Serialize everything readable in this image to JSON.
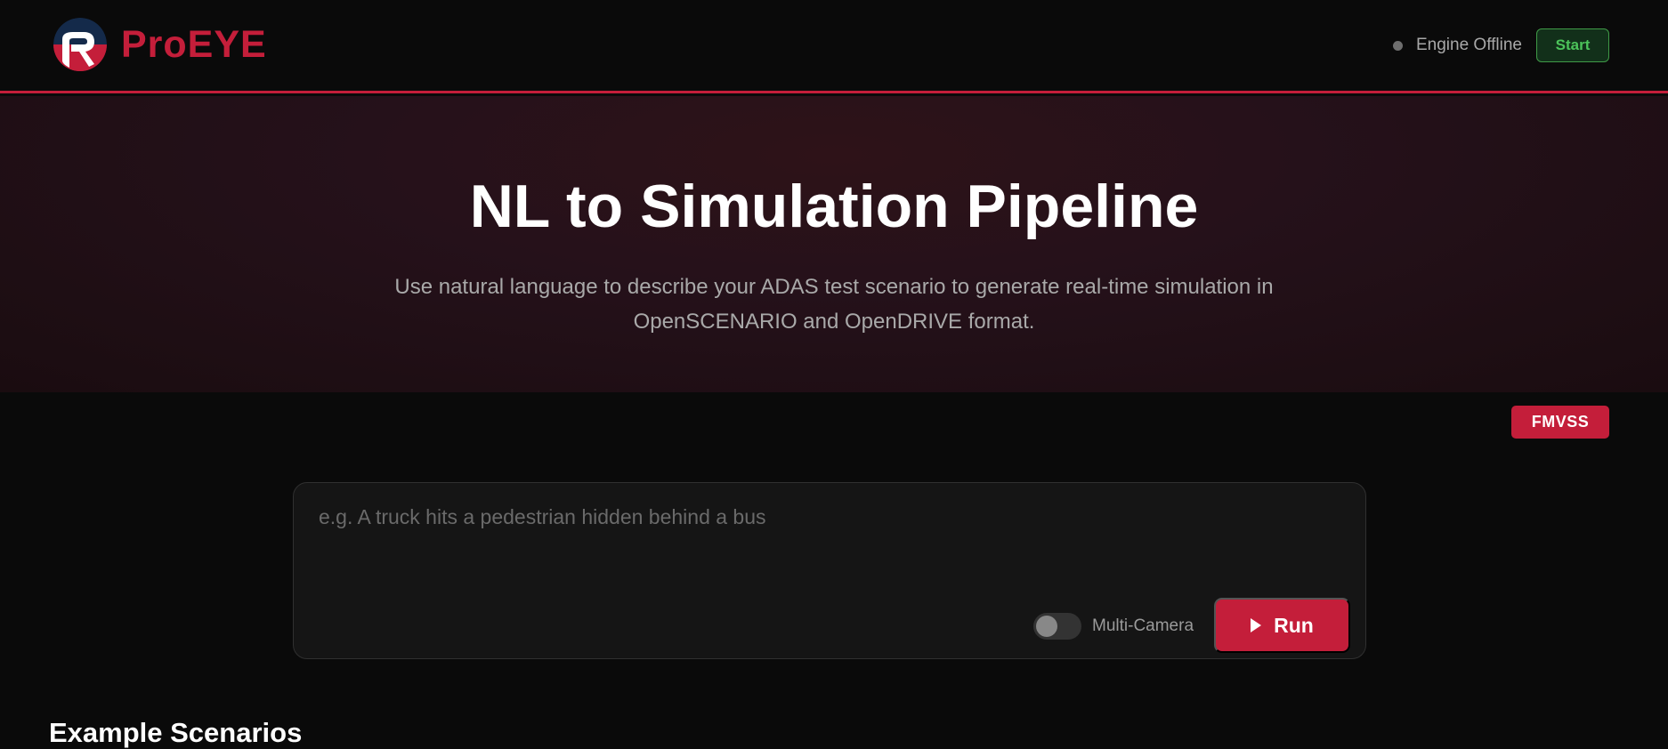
{
  "header": {
    "brand": "ProEYE",
    "engine_status": "Engine Offline",
    "start_label": "Start"
  },
  "hero": {
    "title": "NL to Simulation Pipeline",
    "subtitle_line1": "Use natural language to describe your ADAS test scenario to generate real-time simulation in",
    "subtitle_line2": "OpenSCENARIO and OpenDRIVE format."
  },
  "standard_badge": "FMVSS",
  "prompt": {
    "placeholder": "e.g. A truck hits a pedestrian hidden behind a bus",
    "value": "",
    "multi_camera_label": "Multi-Camera",
    "multi_camera_enabled": false,
    "run_label": "Run"
  },
  "examples": {
    "heading": "Example Scenarios"
  },
  "colors": {
    "brand": "#c41e3a",
    "background": "#0a0a0a",
    "start_green": "#4cc35a",
    "status_offline": "#6e6e6e"
  },
  "icons": {
    "logo": "proeye-logo-icon",
    "status": "status-dot-icon",
    "run": "play-icon",
    "toggle": "toggle-switch"
  }
}
